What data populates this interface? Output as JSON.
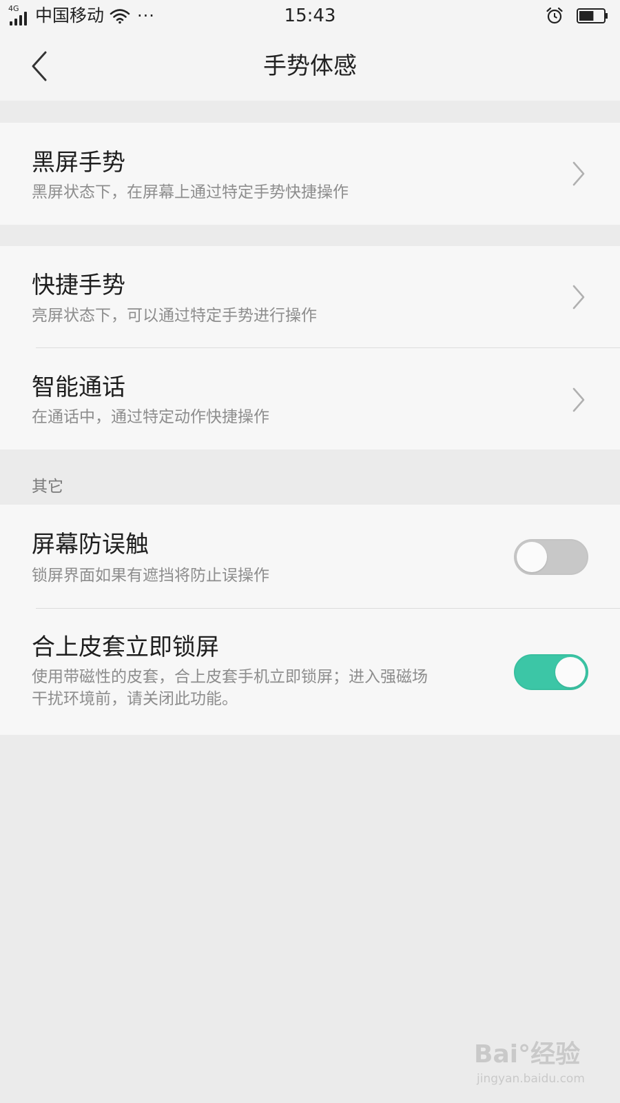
{
  "status_bar": {
    "network_type": "4G",
    "carrier": "中国移动",
    "more": "···",
    "time": "15:43",
    "icons": [
      "signal-icon",
      "wifi-icon",
      "alarm-icon",
      "battery-icon"
    ],
    "battery_level": 0.6
  },
  "header": {
    "title": "手势体感",
    "back_icon": "back-chevron-icon"
  },
  "gesture_section": {
    "items": [
      {
        "title": "黑屏手势",
        "desc": "黑屏状态下，在屏幕上通过特定手势快捷操作"
      }
    ]
  },
  "quick_section": {
    "items": [
      {
        "title": "快捷手势",
        "desc": "亮屏状态下，可以通过特定手势进行操作"
      },
      {
        "title": "智能通话",
        "desc": "在通话中，通过特定动作快捷操作"
      }
    ]
  },
  "other_section": {
    "header": "其它",
    "items": [
      {
        "title": "屏幕防误触",
        "desc": "锁屏界面如果有遮挡将防止误操作",
        "enabled": false
      },
      {
        "title": "合上皮套立即锁屏",
        "desc_line1": "使用带磁性的皮套，合上皮套手机立即锁屏；进入强磁场",
        "desc_line2": "干扰环境前，请关闭此功能。",
        "enabled": true
      }
    ]
  },
  "colors": {
    "toggle_on": "#3cc6a6",
    "toggle_off": "#c8c8c8",
    "page_background": "#ebebeb",
    "card_background": "#f7f7f7"
  },
  "watermark": {
    "brand": "Bai°经验",
    "url": "jingyan.baidu.com"
  }
}
